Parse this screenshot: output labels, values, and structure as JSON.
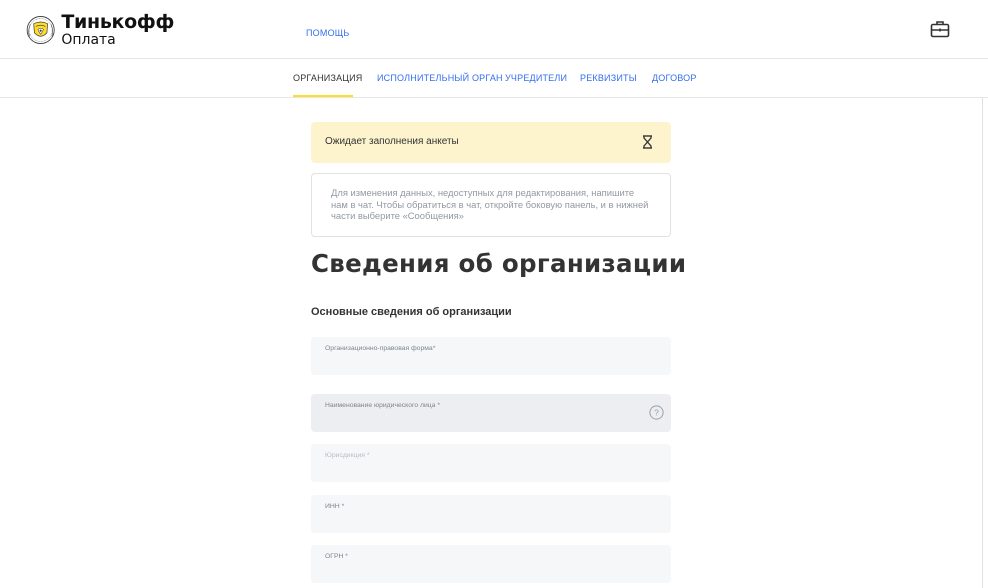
{
  "header": {
    "brand": "Тинькофф",
    "sub_brand": "Оплата",
    "help_link": "Помощь",
    "briefcase_icon": "briefcase-icon"
  },
  "tabs": [
    {
      "label": "Организация",
      "active": true
    },
    {
      "label": "Исполнительный орган",
      "active": false
    },
    {
      "label": "Учредители",
      "active": false
    },
    {
      "label": "Реквизиты",
      "active": false
    },
    {
      "label": "Договор",
      "active": false
    }
  ],
  "status": {
    "text": "Ожидает заполнения анкеты",
    "icon": "hourglass-icon"
  },
  "notice": {
    "text": "Для изменения данных, недоступных для редактирования, напишите нам в чат. Чтобы обратиться в чат, откройте боковую панель, и в нижней части выберите «Сообщения»"
  },
  "page_title": "Сведения об организации",
  "section_title": "Основные сведения об организации",
  "fields": [
    {
      "label": "Организационно-правовая форма*",
      "value": ""
    },
    {
      "label": "Наименование юридического лица *",
      "value": "",
      "help_icon": "question-icon"
    },
    {
      "label": "Юрисдикция *",
      "value": ""
    },
    {
      "label": "ИНН *",
      "value": ""
    },
    {
      "label": "ОГРН *",
      "value": ""
    }
  ],
  "colors": {
    "accent": "#ffdd2d",
    "link": "#336fee",
    "status_bg": "#fdf4cd",
    "field_bg": "#f6f7f8"
  }
}
